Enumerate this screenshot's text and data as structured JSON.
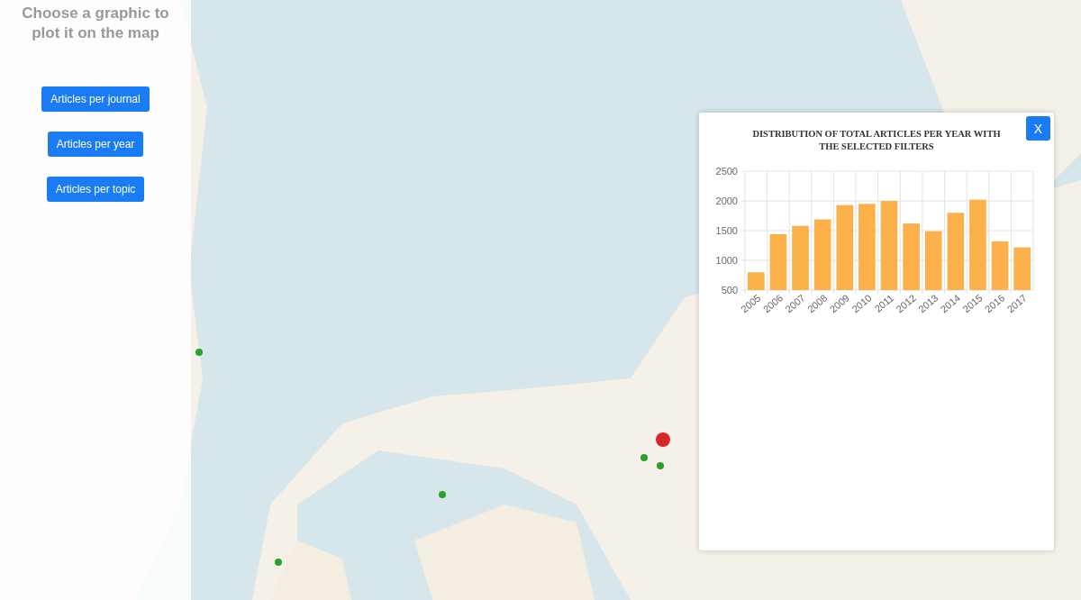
{
  "sidebar": {
    "title": "Choose a graphic to plot it on the map",
    "buttons": [
      {
        "label": "Articles per journal"
      },
      {
        "label": "Articles per year"
      },
      {
        "label": "Articles per topic"
      }
    ]
  },
  "popup": {
    "close_label": "X",
    "chart_data": {
      "type": "bar",
      "title": "DISTRIBUTION OF TOTAL ARTICLES PER YEAR WITH THE SELECTED FILTERS",
      "categories": [
        "2005",
        "2006",
        "2007",
        "2008",
        "2009",
        "2010",
        "2011",
        "2012",
        "2013",
        "2014",
        "2015",
        "2016",
        "2017"
      ],
      "grid": true,
      "series": [
        {
          "color": "#fbb04a",
          "values": [
            800,
            1440,
            1580,
            1690,
            1930,
            1950,
            2000,
            1620,
            1490,
            1800,
            2020,
            1320,
            1220
          ]
        }
      ],
      "ylim": [
        500,
        2500
      ],
      "yticks": [
        500,
        1000,
        1500,
        2000,
        2500
      ]
    }
  }
}
